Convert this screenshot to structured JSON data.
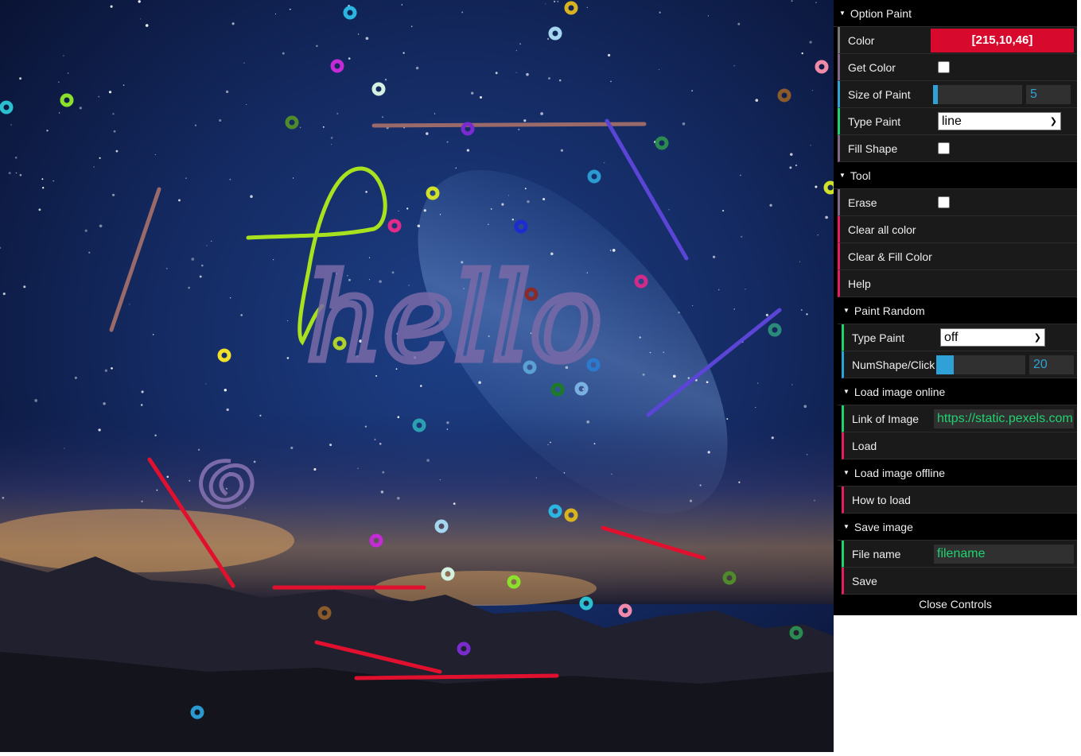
{
  "canvas": {
    "hello_text": "hello",
    "hello_color": "#7a6aa8",
    "stroke_colors": {
      "green": "#a8e21f",
      "purple": "#5a45d6",
      "mauve": "#9a6a6a",
      "red": "#e0102e",
      "scribble": "#7a6aa8"
    },
    "ring_colors": [
      "#2bb5e0",
      "#d9b21f",
      "#a5d6f0",
      "#c42bd6",
      "#d3f0e0",
      "#8ae02b",
      "#4f8a2b",
      "#2bc0d0",
      "#f08aa8",
      "#8a5a2a",
      "#7a2bd0",
      "#2b8a4f",
      "#2b9ad0",
      "#d0e02b",
      "#e02b8a",
      "#1e2bd0",
      "#d02b8a",
      "#8a2a2a",
      "#2b8a7a",
      "#b0d02b",
      "#f0e02b",
      "#5aa0d0",
      "#2b7ad0",
      "#1e7a2b",
      "#7ab0e0",
      "#2ba0b0"
    ]
  },
  "gui": {
    "option_paint": {
      "title": "Option Paint",
      "color_label": "Color",
      "color_value": "[215,10,46]",
      "color_hex": "#d70a2e",
      "get_color_label": "Get Color",
      "size_label": "Size of Paint",
      "size_value": "5",
      "size_fraction": 0.05,
      "type_label": "Type Paint",
      "type_value": "line",
      "fill_label": "Fill Shape"
    },
    "tool": {
      "title": "Tool",
      "erase_label": "Erase",
      "clear_all": "Clear all color",
      "clear_fill": "Clear & Fill Color",
      "help": "Help",
      "paint_random": {
        "title": "Paint Random",
        "type_label": "Type Paint",
        "type_value": "off",
        "num_label": "NumShape/Click",
        "num_value": "20",
        "num_fraction": 0.2
      },
      "load_online": {
        "title": "Load image online",
        "link_label": "Link of Image",
        "link_value": "https://static.pexels.com",
        "load": "Load"
      },
      "load_offline": {
        "title": "Load image offline",
        "how": "How to load"
      },
      "save": {
        "title": "Save image",
        "file_label": "File name",
        "file_value": "filename",
        "save": "Save"
      }
    },
    "close_controls": "Close Controls"
  }
}
